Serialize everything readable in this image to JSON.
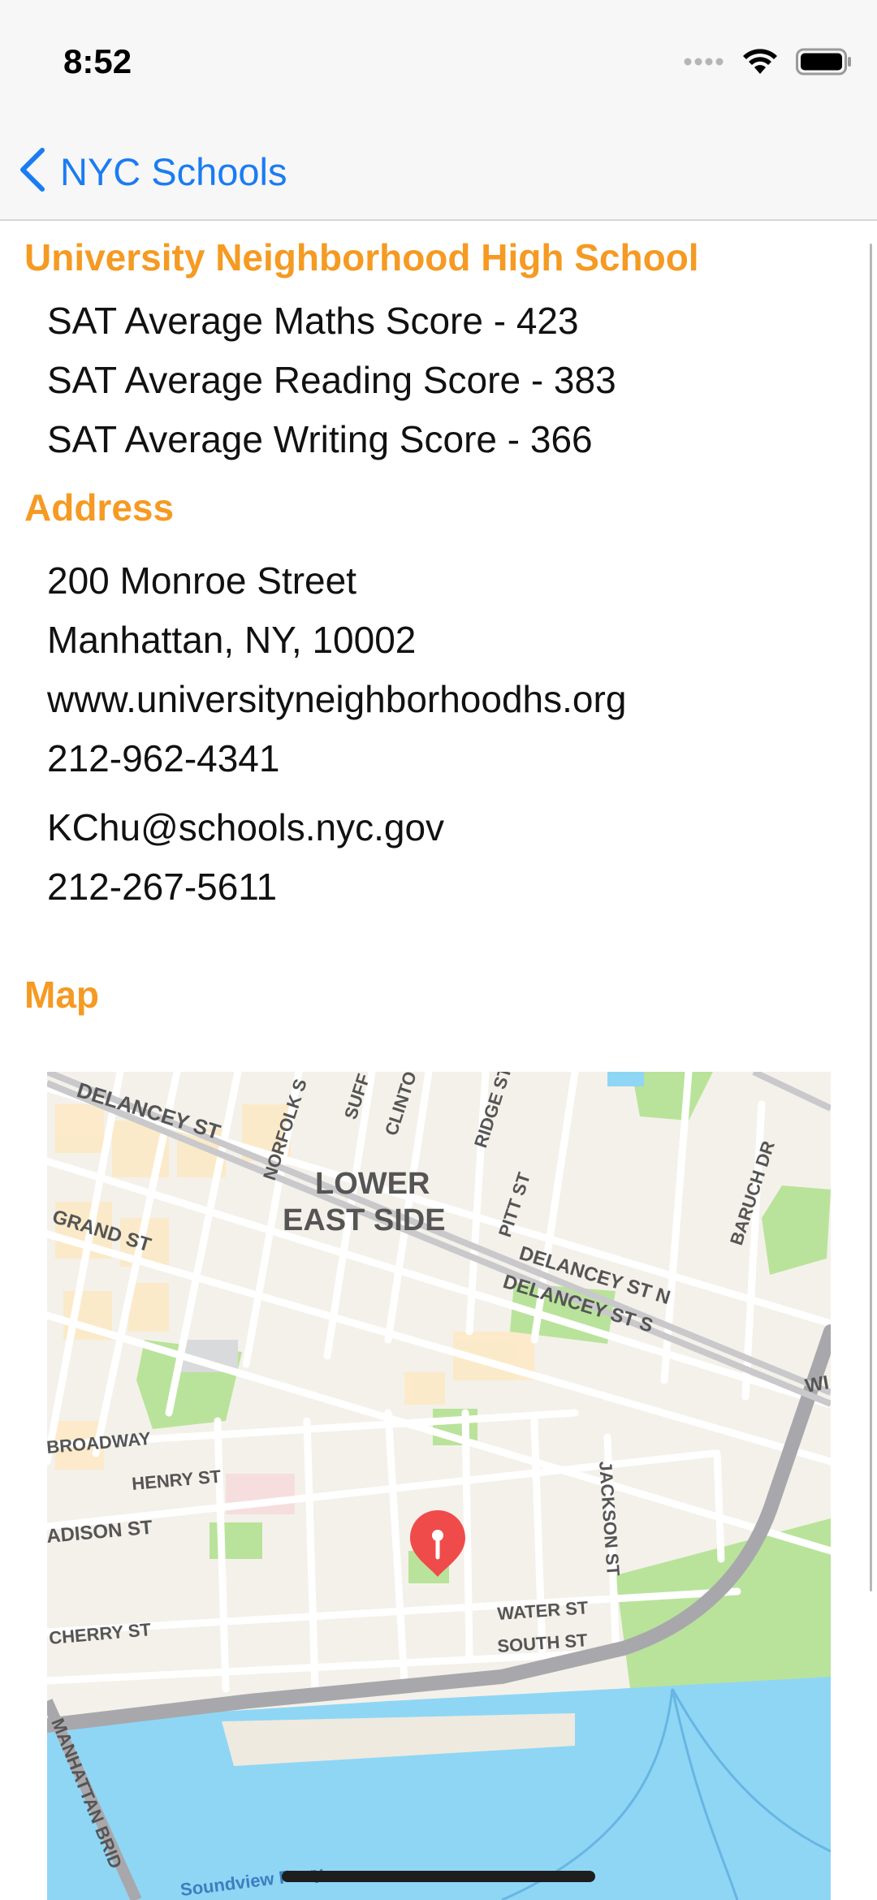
{
  "status_bar": {
    "time": "8:52",
    "icons": [
      "signal-dots-icon",
      "wifi-icon",
      "battery-icon"
    ]
  },
  "nav": {
    "back_label": "NYC Schools",
    "accent_color": "#1a7cf2"
  },
  "school": {
    "name": "University Neighborhood High School",
    "sat_math": "SAT Average Maths Score - 423",
    "sat_reading": "SAT Average Reading Score - 383",
    "sat_writing": "SAT Average Writing Score - 366"
  },
  "address": {
    "title": "Address",
    "street": "200 Monroe Street",
    "city_line": "Manhattan, NY, 10002",
    "website": "www.universityneighborhoodhs.org",
    "phone": "212-962-4341",
    "email": "KChu@schools.nyc.gov",
    "fax": "212-267-5611"
  },
  "map": {
    "title": "Map",
    "labels": {
      "delancey_st": "DELANCEY ST",
      "norfolk": "NORFOLK S",
      "suffolk": "SUFF",
      "clinton": "CLINTO",
      "ridge": "RIDGE ST",
      "lower": "LOWER",
      "east_side": "EAST SIDE",
      "pitt": "PITT ST",
      "baruch": "BARUCH DR",
      "grand": "GRAND ST",
      "delancey_n": "DELANCEY ST N",
      "delancey_s": "DELANCEY ST S",
      "broadway": "BROADWAY",
      "henry": "HENRY ST",
      "jackson": "JACKSON ST",
      "madison": "ADISON ST",
      "cherry": "CHERRY ST",
      "water": "WATER ST",
      "south": "SOUTH ST",
      "manhattan_bridge": "MANHATTAN BRID",
      "ferry": "Soundview Ferry",
      "edge": "WI"
    },
    "pin_color": "#f04b4b",
    "water_color": "#8fd6f5",
    "park_color": "#b9e39a"
  },
  "accent": {
    "section_color": "#f59a22"
  }
}
